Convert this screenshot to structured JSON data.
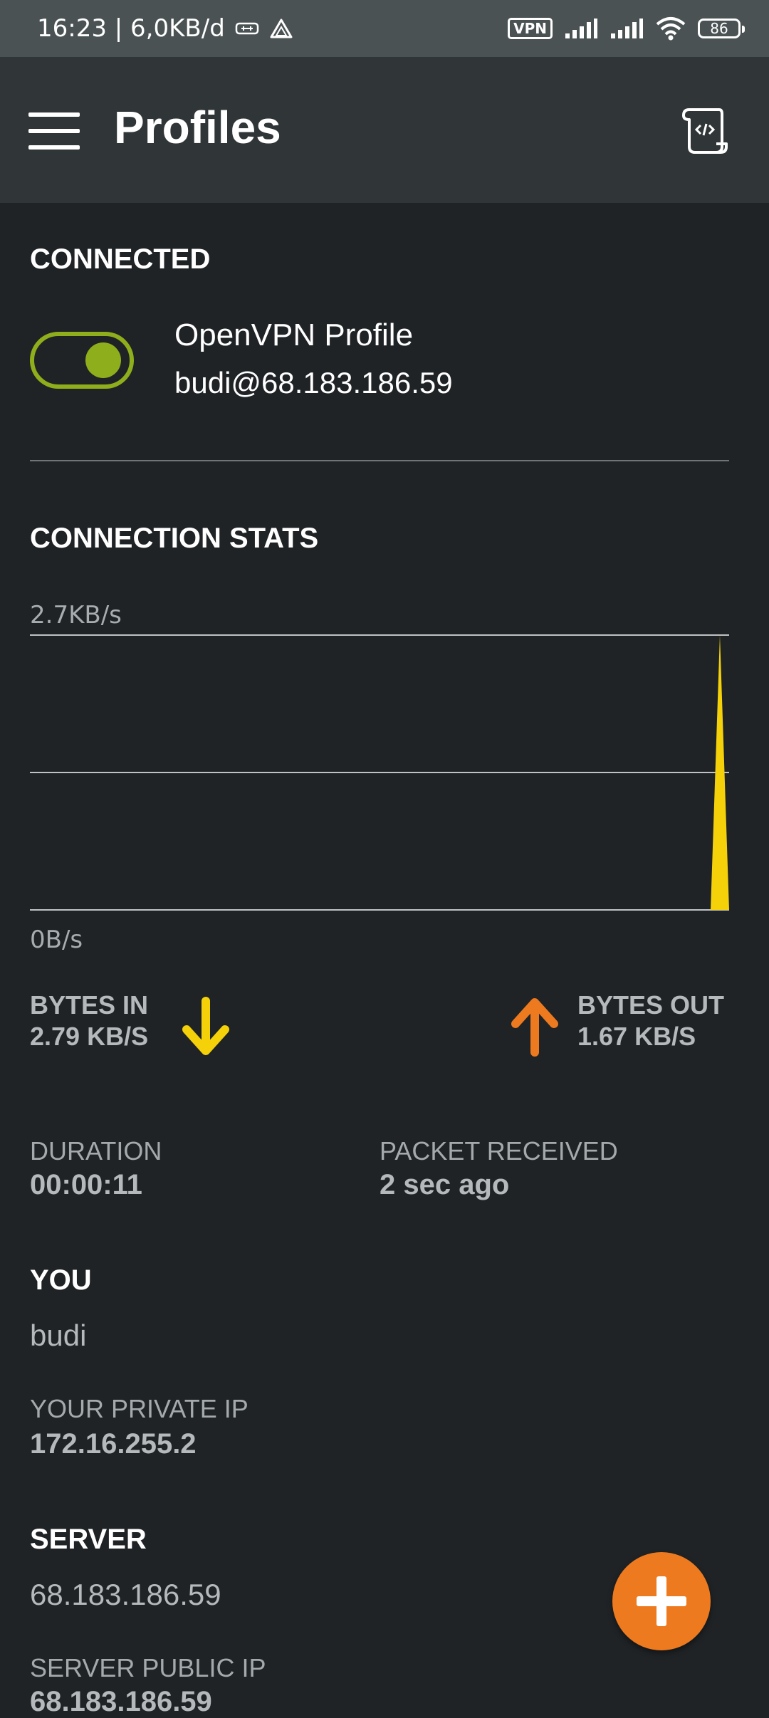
{
  "status_bar": {
    "time_speed": "16:23 | 6,0KB/d",
    "vpn_badge": "VPN",
    "battery": "86"
  },
  "app_bar": {
    "title": "Profiles",
    "menu_icon": "hamburger-menu-icon",
    "action_icon": "log-scroll-icon"
  },
  "connected": {
    "section_title": "CONNECTED",
    "toggle_on": true,
    "profile_name": "OpenVPN Profile",
    "profile_user_host": "budi@68.183.186.59",
    "accent_color": "#8fae1b"
  },
  "stats": {
    "section_title": "CONNECTION STATS",
    "chart_data": {
      "type": "area",
      "y_max_label": "2.7KB/s",
      "y_min_label": "0B/s",
      "series": [
        {
          "values": [
            0,
            0,
            0,
            0,
            0,
            0,
            0,
            0,
            0,
            0,
            0,
            0,
            0,
            0,
            0,
            0,
            0,
            0,
            0,
            0,
            2.7
          ]
        }
      ],
      "color": "#f5d10a"
    },
    "bytes_in_label": "BYTES IN",
    "bytes_in_value": "2.79 KB/S",
    "bytes_out_label": "BYTES OUT",
    "bytes_out_value": "1.67 KB/S",
    "in_color": "#f5d10a",
    "out_color": "#ee7a1f"
  },
  "details": {
    "duration_label": "DURATION",
    "duration_value": "00:00:11",
    "packet_label": "PACKET RECEIVED",
    "packet_value": "2 sec ago",
    "you_title": "YOU",
    "you_value": "budi",
    "private_ip_label": "YOUR PRIVATE IP",
    "private_ip_value": "172.16.255.2",
    "server_title": "SERVER",
    "server_value": "68.183.186.59",
    "server_public_ip_label": "SERVER PUBLIC IP",
    "server_public_ip_value": "68.183.186.59"
  },
  "fab": {
    "icon": "plus-icon",
    "color": "#ee7a1f"
  }
}
